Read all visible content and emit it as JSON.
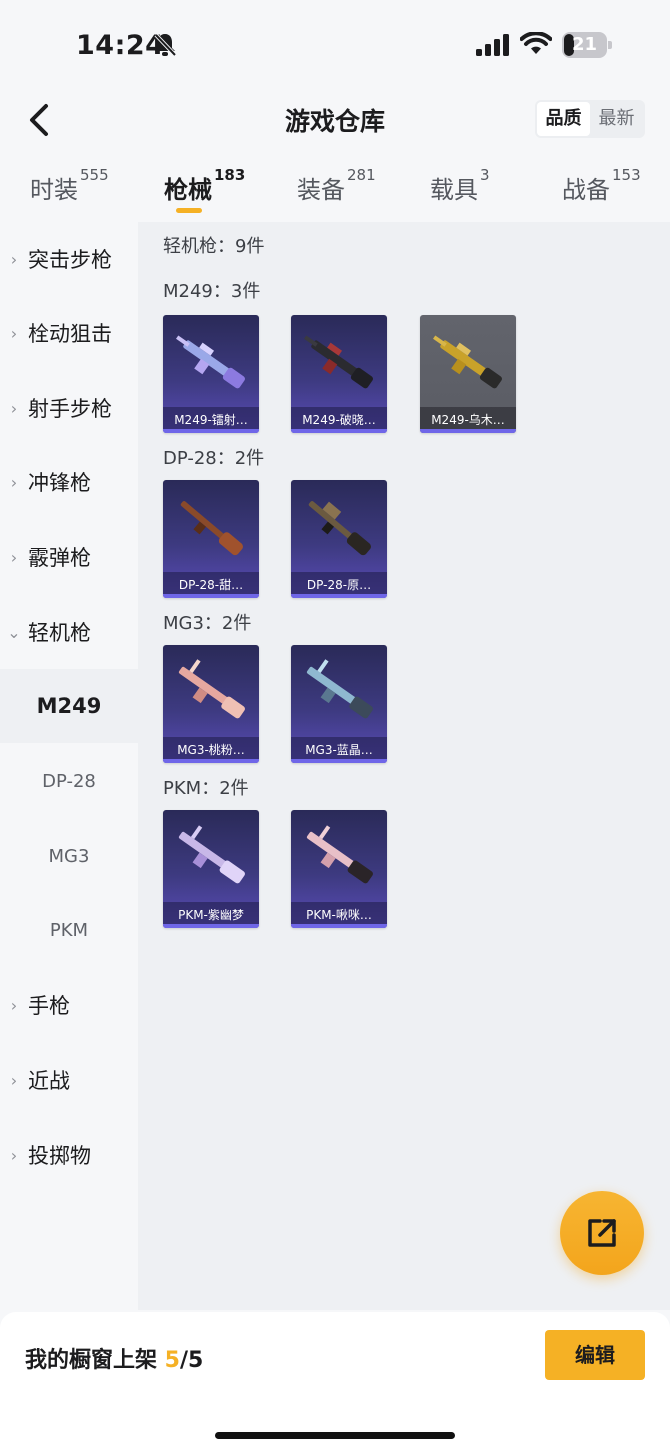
{
  "status_bar": {
    "time": "14:24",
    "battery": "21"
  },
  "header": {
    "title": "游戏仓库",
    "sort_options": [
      "品质",
      "最新"
    ]
  },
  "tabs": [
    {
      "label": "时装",
      "count": "555"
    },
    {
      "label": "枪械",
      "count": "183"
    },
    {
      "label": "装备",
      "count": "281"
    },
    {
      "label": "载具",
      "count": "3"
    },
    {
      "label": "战备",
      "count": "153"
    }
  ],
  "sidebar": {
    "items": [
      {
        "label": "突击步枪"
      },
      {
        "label": "栓动狙击"
      },
      {
        "label": "射手步枪"
      },
      {
        "label": "冲锋枪"
      },
      {
        "label": "霰弹枪"
      },
      {
        "label": "轻机枪"
      },
      {
        "label": "M249"
      },
      {
        "label": "DP-28"
      },
      {
        "label": "MG3"
      },
      {
        "label": "PKM"
      },
      {
        "label": "手枪"
      },
      {
        "label": "近战"
      },
      {
        "label": "投掷物"
      }
    ]
  },
  "content": {
    "category_title": "轻机枪：9件",
    "groups": [
      {
        "title": "M249：3件",
        "items": [
          "M249-镭射…",
          "M249-破晓…",
          "M249-乌木…"
        ]
      },
      {
        "title": "DP-28：2件",
        "items": [
          "DP-28-甜…",
          "DP-28-原…"
        ]
      },
      {
        "title": "MG3：2件",
        "items": [
          "MG3-桃粉…",
          "MG3-蓝晶…"
        ]
      },
      {
        "title": "PKM：2件",
        "items": [
          "PKM-紫幽梦",
          "PKM-啾咪…"
        ]
      }
    ]
  },
  "bottom_bar": {
    "showcase_label": "我的橱窗上架 ",
    "count": "5",
    "total": "/5",
    "edit_label": "编辑"
  },
  "colors": {
    "accent": "#f5b125",
    "quality_purple": "#6f66e8"
  },
  "icons": [
    "bell-slash-icon",
    "signal-icon",
    "wifi-icon",
    "battery-icon",
    "back-arrow-icon",
    "chevron-right-icon",
    "chevron-down-icon",
    "share-icon"
  ]
}
